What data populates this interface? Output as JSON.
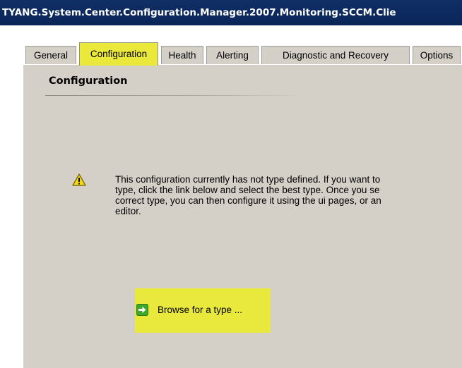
{
  "window": {
    "title": "TYANG.System.Center.Configuration.Manager.2007.Monitoring.SCCM.Clie"
  },
  "tabs": [
    {
      "label": "General",
      "active": false
    },
    {
      "label": "Configuration",
      "active": true
    },
    {
      "label": "Health",
      "active": false
    },
    {
      "label": "Alerting",
      "active": false
    },
    {
      "label": "Diagnostic and Recovery",
      "active": false
    },
    {
      "label": "Options",
      "active": false
    }
  ],
  "panel": {
    "heading": "Configuration",
    "warning": {
      "icon": "warning-icon",
      "lines": [
        "This configuration currently has not type defined.  If you want to",
        "type, click the link below and select the best type.  Once you se",
        "correct type, you can then configure it using the ui pages, or an",
        "editor."
      ]
    },
    "browse": {
      "icon": "green-arrow-icon",
      "label": "Browse for a type ..."
    }
  },
  "colors": {
    "title_bar": "#0f2f66",
    "panel_background": "#d4d0c8",
    "highlight": "#ebe83c",
    "arrow_green": "#3ea82a"
  }
}
